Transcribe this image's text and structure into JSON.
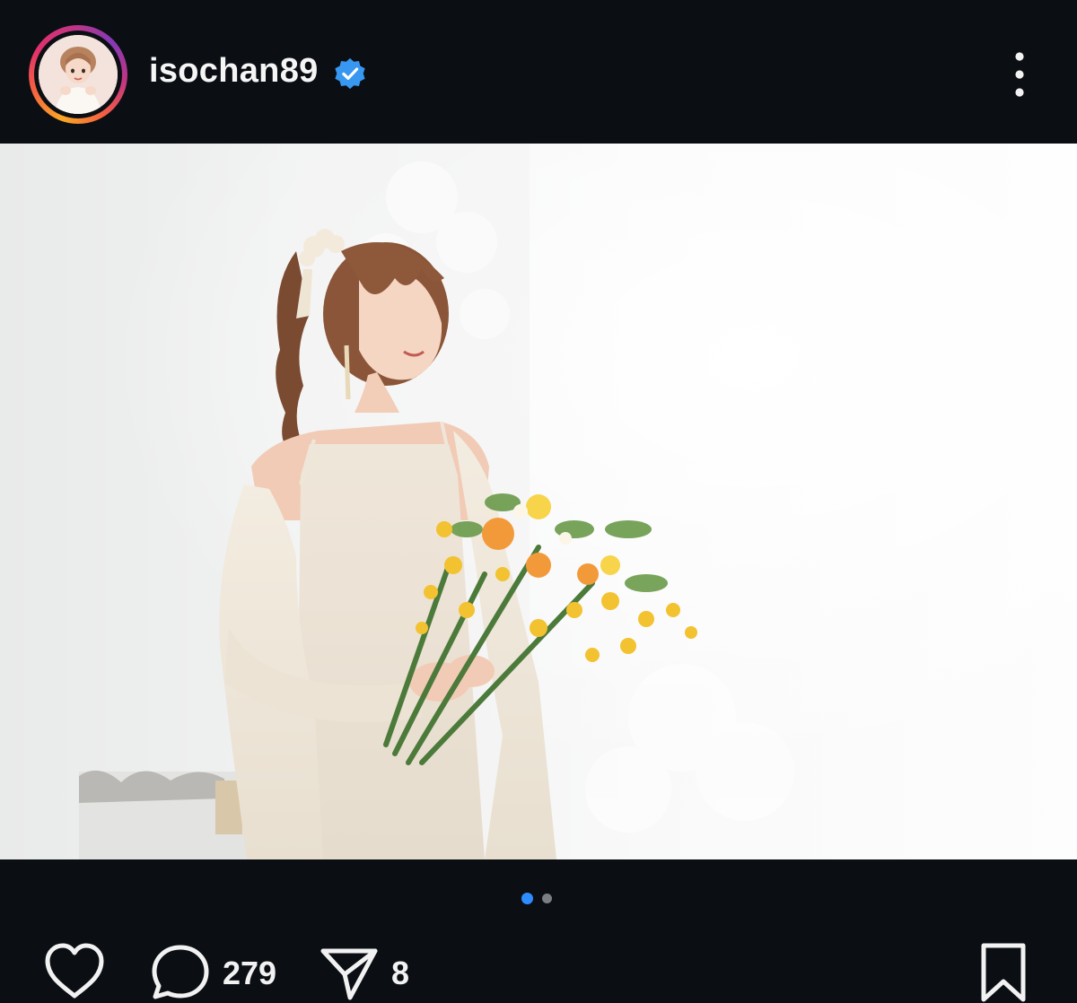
{
  "post": {
    "username": "isochan89",
    "verified": true,
    "avatar_icon": "profile-photo",
    "more_icon": "more-vertical-icon"
  },
  "carousel": {
    "total": 2,
    "active_index": 0,
    "active_color": "#2f8cff",
    "inactive_color": "#7a7f86"
  },
  "actions": {
    "like_icon": "heart-icon",
    "comment_icon": "comment-icon",
    "comment_count": "279",
    "share_icon": "send-icon",
    "share_count": "8",
    "save_icon": "bookmark-icon"
  },
  "colors": {
    "background": "#0b0f14",
    "verified_badge": "#3897f0",
    "story_ring": [
      "#f9a825",
      "#e1306c",
      "#833ab4"
    ]
  }
}
